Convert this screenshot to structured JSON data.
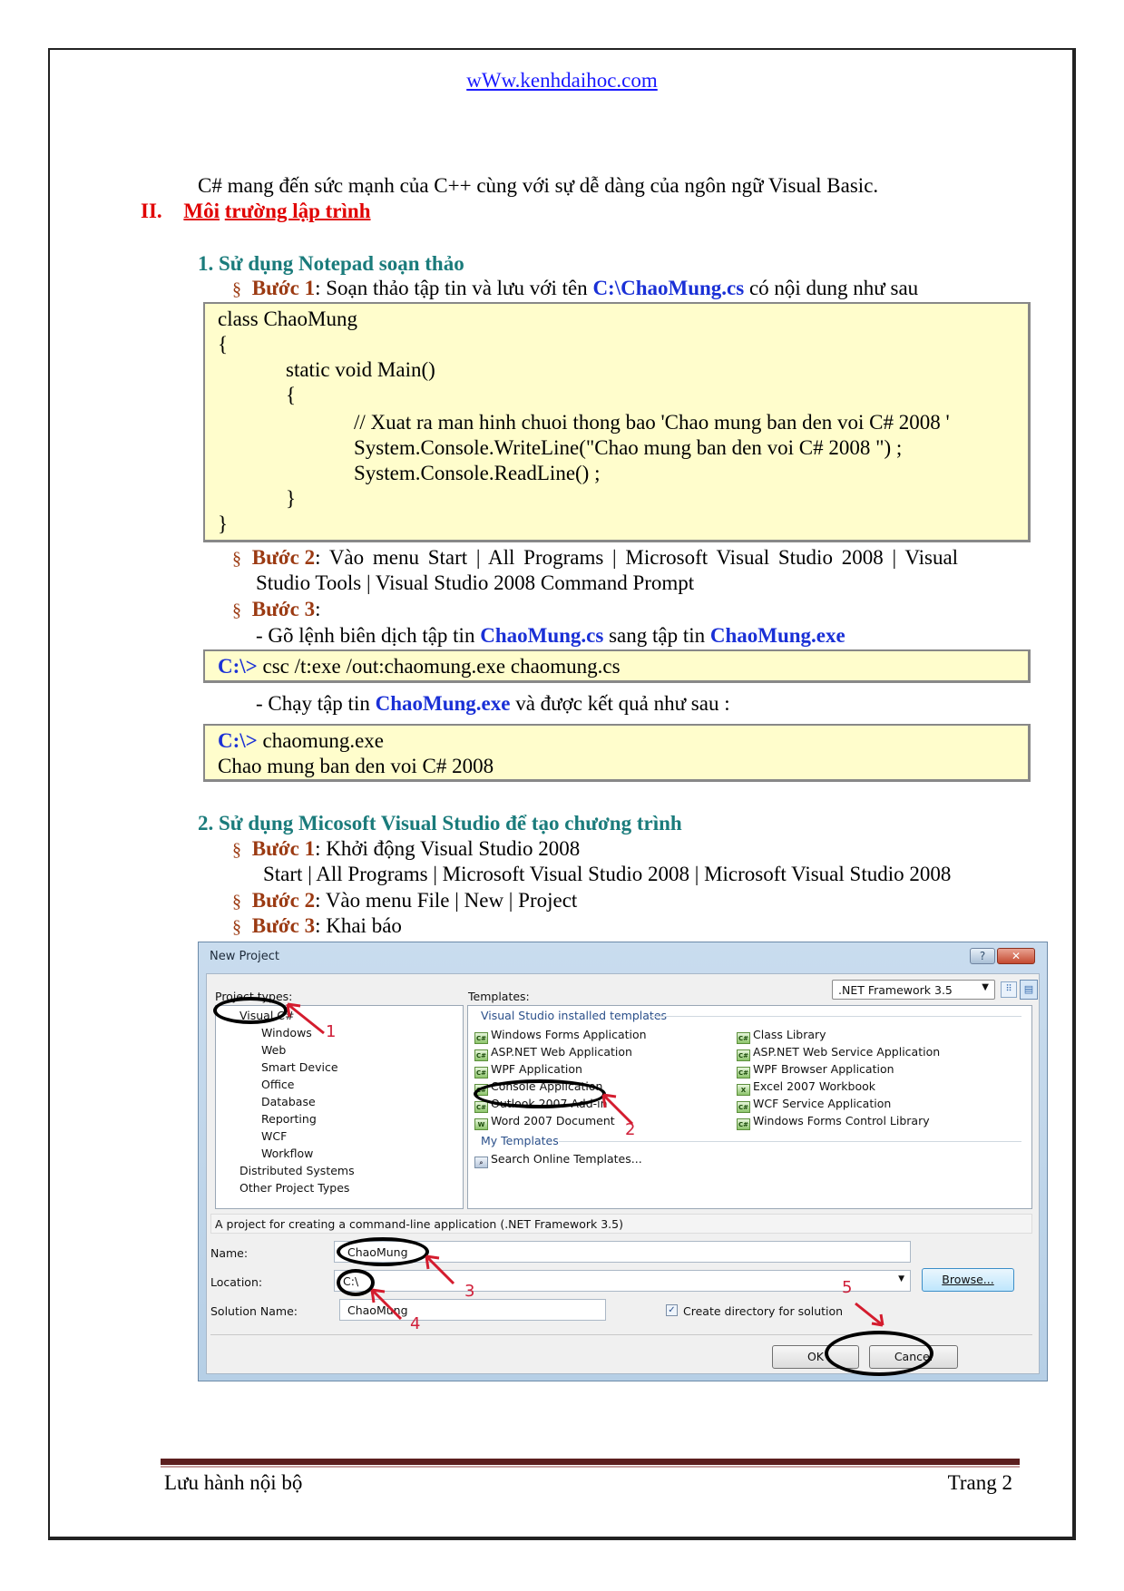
{
  "header": {
    "site_link": "wWw.kenhdaihoc.com"
  },
  "intro_text": "C# mang đến sức mạnh của C++ cùng với sự dễ dàng của ngôn ngữ Visual Basic.",
  "section": {
    "number": "II.",
    "title_word1": "Môi",
    "title_rest": "trường lập trình"
  },
  "part1": {
    "heading": "1.   Sử dụng Notepad soạn thảo",
    "bullet": "§",
    "step1": {
      "label": "Bước 1",
      "text_before": ": Soạn thảo tập tin và lưu với tên ",
      "filename": "C:\\ChaoMung.cs",
      "text_after": " có nội dung như sau"
    },
    "code_lines": [
      "class ChaoMung",
      "{",
      "static void Main()",
      "{",
      "// Xuat ra man hinh chuoi thong bao 'Chao mung ban den voi C# 2008 '",
      "System.Console.WriteLine(\"Chao mung ban den voi C# 2008 \") ;",
      "System.Console.ReadLine() ;",
      "}",
      "}"
    ],
    "step2": {
      "label": "Bước 2",
      "text_line1": ": Vào menu Start | All Programs | Microsoft Visual Studio 2008 | Visual",
      "text_line2": "Studio Tools | Visual Studio 2008 Command Prompt"
    },
    "step3": {
      "label": "Bước 3",
      "text": ":"
    },
    "compile_instr": {
      "before": "- Gõ lệnh biên dịch tập tin ",
      "src": "ChaoMung.cs",
      "mid": " sang tập tin ",
      "dst": "ChaoMung.exe"
    },
    "compile_cmd": {
      "prompt": "C:\\>",
      "command": " csc /t:exe /out:chaomung.exe chaomung.cs"
    },
    "run_instr": {
      "before": "- Chạy tập tin ",
      "exe": "ChaoMung.exe",
      "after": " và được kết quả như sau :"
    },
    "run_output": {
      "prompt": "C:\\>",
      "command": " chaomung.exe",
      "output": "Chao mung ban den voi C# 2008"
    }
  },
  "part2": {
    "heading": "2.   Sử dụng Micosoft Visual Studio để tạo chương trình",
    "step1": {
      "label": "Bước 1",
      "text": ": Khởi động Visual Studio 2008",
      "path": "Start | All Programs | Microsoft Visual Studio 2008 | Microsoft Visual Studio 2008"
    },
    "step2": {
      "label": "Bước 2",
      "text": ": Vào menu File | New | Project"
    },
    "step3": {
      "label": "Bước 3",
      "text": ": Khai báo"
    }
  },
  "dialog": {
    "title": "New Project",
    "help_glyph": "?",
    "close_glyph": "✕",
    "project_types_label": "Project types:",
    "project_types": [
      {
        "label": "Visual C#",
        "level": 1,
        "selected": true
      },
      {
        "label": "Windows",
        "level": 2
      },
      {
        "label": "Web",
        "level": 2
      },
      {
        "label": "Smart Device",
        "level": 2
      },
      {
        "label": "Office",
        "level": 2
      },
      {
        "label": "Database",
        "level": 2
      },
      {
        "label": "Reporting",
        "level": 2
      },
      {
        "label": "WCF",
        "level": 2
      },
      {
        "label": "Workflow",
        "level": 2
      },
      {
        "label": "Distributed Systems",
        "level": 1
      },
      {
        "label": "Other Project Types",
        "level": 1
      }
    ],
    "templates_label": "Templates:",
    "framework_select": ".NET Framework 3.5",
    "installed_group": "Visual Studio installed templates",
    "templates_left": [
      "Windows Forms Application",
      "ASP.NET Web Application",
      "WPF Application",
      "Console Application",
      "Outlook 2007 Add-in",
      "Word 2007 Document"
    ],
    "templates_right": [
      "Class Library",
      "ASP.NET Web Service Application",
      "WPF Browser Application",
      "Excel 2007 Workbook",
      "WCF Service Application",
      "Windows Forms Control Library"
    ],
    "selected_template": "Console Application",
    "my_templates_group": "My Templates",
    "search_online": "Search Online Templates...",
    "description": "A project for creating a command-line application (.NET Framework 3.5)",
    "name_label": "Name:",
    "name_value": "ChaoMung",
    "location_label": "Location:",
    "location_value": "C:\\",
    "solution_label": "Solution Name:",
    "solution_value": "ChaoMung",
    "create_dir_label": "Create directory for solution",
    "create_dir_checked": true,
    "browse_button": "Browse...",
    "ok_button": "OK",
    "cancel_button": "Cancel",
    "annotations": [
      "1",
      "2",
      "3",
      "4",
      "5"
    ]
  },
  "footer": {
    "left": "Lưu hành nội bộ",
    "right": "Trang 2"
  },
  "colors": {
    "heading_red": "#e00000",
    "teal": "#1a7b7b",
    "brown": "#9b3a12",
    "blue": "#1a30d6",
    "code_bg": "#fffdcc",
    "footer_bar": "#5c1f1f"
  }
}
